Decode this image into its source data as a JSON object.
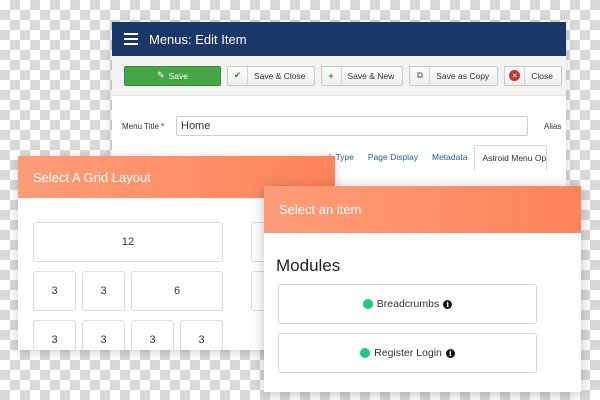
{
  "admin": {
    "title": "Menus: Edit Item",
    "toolbar": {
      "save": "Save",
      "save_close": "Save & Close",
      "save_new": "Save & New",
      "save_copy": "Save as Copy",
      "close": "Close"
    },
    "menu_title_label": "Menu Title *",
    "menu_title_value": "Home",
    "alias_label": "Alias",
    "tabs": [
      "k Type",
      "Page Display",
      "Metadata",
      "Astroid Menu Op"
    ]
  },
  "grid_panel": {
    "title": "Select A Grid Layout",
    "cells": [
      "12",
      "3",
      "3",
      "6",
      "3",
      "3",
      "3",
      "3"
    ]
  },
  "item_panel": {
    "title": "Select an item",
    "section_title": "Modules",
    "modules": [
      "Breadcrumbs",
      "Register Login"
    ]
  },
  "colors": {
    "header_blue": "#1a3867",
    "save_green": "#46a546",
    "orange_gradient_start": "#fd9d79",
    "orange_gradient_end": "#ff845b",
    "module_dot": "#1fc77b"
  },
  "icons": [
    "menu-icon",
    "save-icon",
    "check-icon",
    "plus-icon",
    "copy-icon",
    "close-icon",
    "info-icon"
  ]
}
